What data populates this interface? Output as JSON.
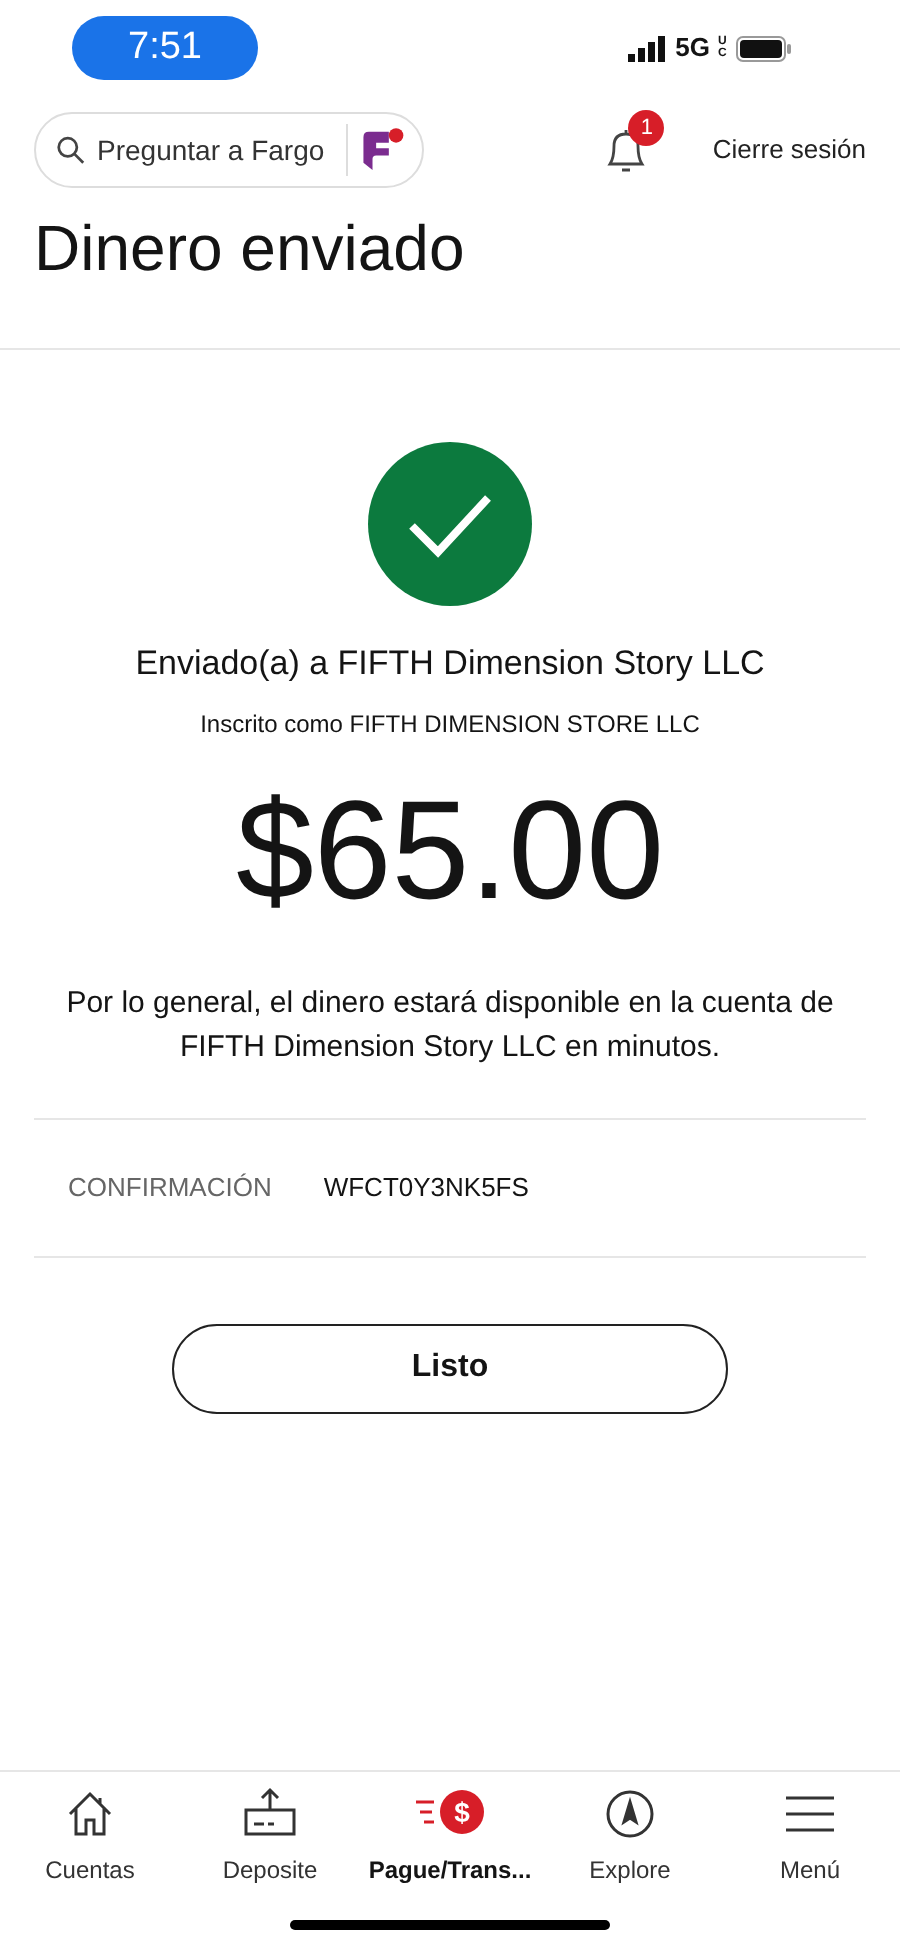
{
  "status_bar": {
    "time": "7:51",
    "network": "5G",
    "network_suffix": "UC"
  },
  "header": {
    "search": {
      "placeholder": "Preguntar a Fargo"
    },
    "notifications": {
      "count": "1"
    },
    "logout": "Cierre sesión"
  },
  "title": "Dinero enviado",
  "confirmation": {
    "sent_to": "Enviado(a) a FIFTH Dimension Story LLC",
    "registered_as": "Inscrito como FIFTH DIMENSION STORE LLC",
    "amount": "$65.00",
    "note": "Por lo general, el dinero estará disponible en la cuenta de FIFTH Dimension Story LLC en minutos.",
    "label": "CONFIRMACIÓN",
    "code": "WFCT0Y3NK5FS"
  },
  "done_button": "Listo",
  "tab_bar": [
    {
      "label": "Cuentas",
      "kind": "home",
      "selected": false
    },
    {
      "label": "Deposite",
      "kind": "deposit",
      "selected": false
    },
    {
      "label": "Pague/Trans...",
      "kind": "pay",
      "icon_text": "$",
      "selected": true
    },
    {
      "label": "Explore",
      "kind": "explore",
      "selected": false
    },
    {
      "label": "Menú",
      "kind": "menu",
      "selected": false
    }
  ]
}
